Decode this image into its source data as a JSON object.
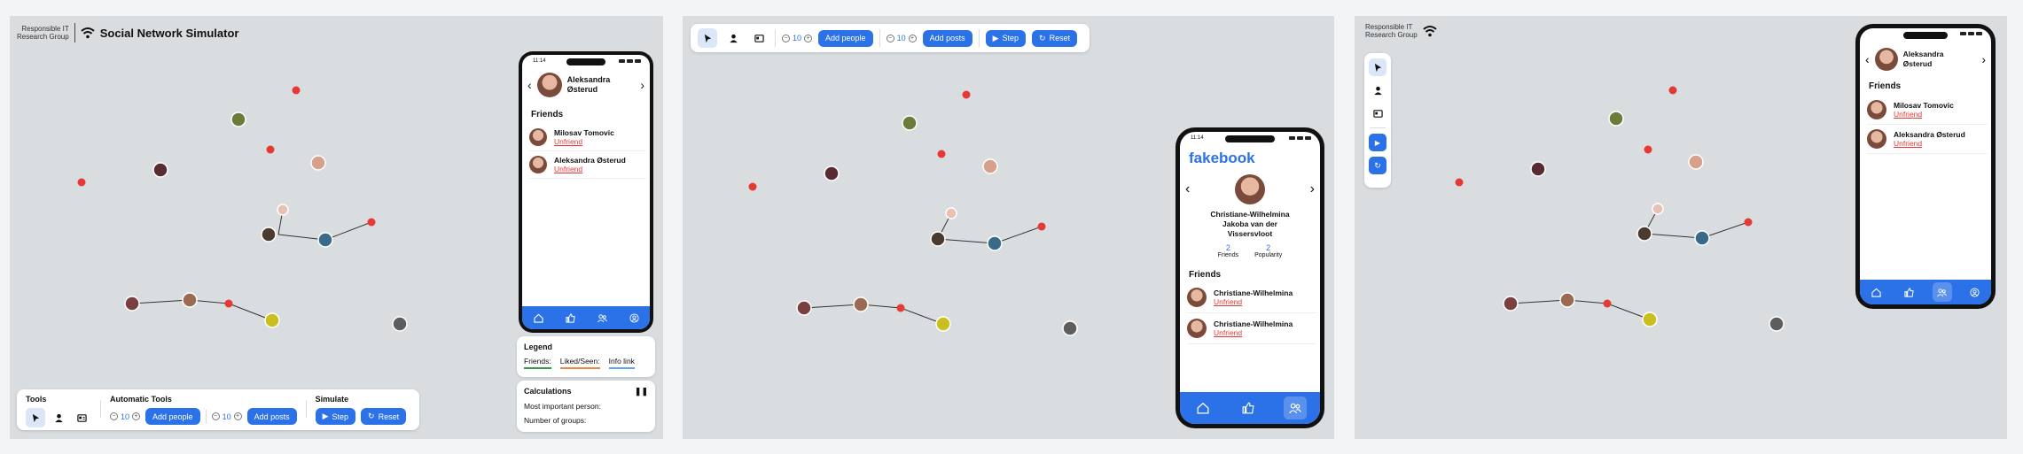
{
  "brand": {
    "org_line1": "Responsible IT",
    "org_line2": "Research Group",
    "app_title": "Social Network Simulator"
  },
  "toolbar": {
    "tools_label": "Tools",
    "auto_label": "Automatic Tools",
    "simulate_label": "Simulate",
    "people_count": "10",
    "posts_count": "10",
    "add_people": "Add people",
    "add_posts": "Add posts",
    "step": "Step",
    "reset": "Reset"
  },
  "phone1": {
    "time": "11:14",
    "profile_name_1": "Aleksandra",
    "profile_name_2": "Østerud",
    "friends_title": "Friends",
    "friends": [
      {
        "name": "Milosav Tomovic",
        "action": "Unfriend"
      },
      {
        "name": "Aleksandra Østerud",
        "action": "Unfriend"
      }
    ]
  },
  "legend": {
    "title": "Legend",
    "friends": "Friends:",
    "liked": "Liked/Seen:",
    "info": "Info link",
    "colors": {
      "friends": "#2ea043",
      "liked": "#f0883e",
      "info": "#58a6ff"
    }
  },
  "calculations": {
    "title": "Calculations",
    "important": "Most important person:",
    "groups": "Number of groups:"
  },
  "phone2": {
    "time": "11:14",
    "logo": "fakebook",
    "name_1": "Christiane-Wilhelmina",
    "name_2": "Jakoba van der",
    "name_3": "Vissersvloot",
    "friends_count": "2",
    "friends_label": "Friends",
    "popularity_count": "2",
    "popularity_label": "Popularity",
    "friends_title": "Friends",
    "friends": [
      {
        "name": "Christiane-Wilhelmina",
        "action": "Unfriend"
      },
      {
        "name": "Christiane-Wilhelmina",
        "action": "Unfriend"
      }
    ]
  },
  "phone3": {
    "profile_name_1": "Aleksandra",
    "profile_name_2": "Østerud",
    "friends_title": "Friends",
    "friends": [
      {
        "name": "Milosav Tomovic",
        "action": "Unfriend"
      },
      {
        "name": "Aleksandra Østerud",
        "action": "Unfriend"
      }
    ]
  },
  "colors": {
    "accent": "#2b72e8",
    "red_node": "#e53935",
    "unfriend": "#e53935"
  }
}
